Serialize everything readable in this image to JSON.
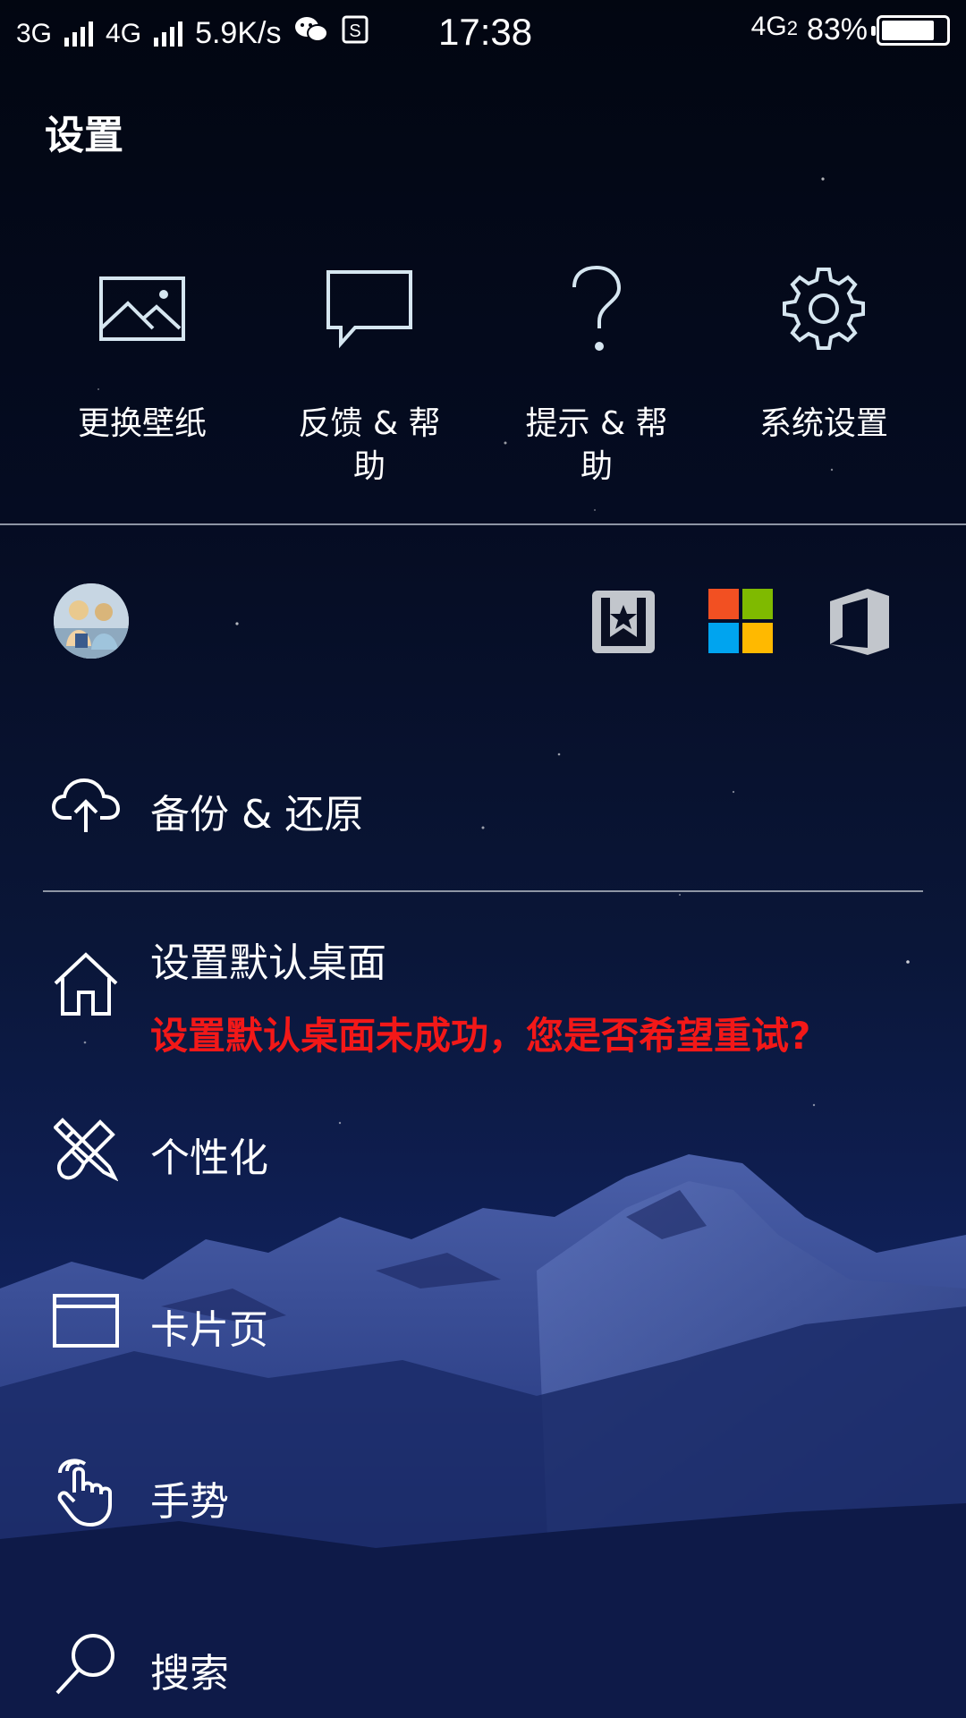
{
  "status_bar": {
    "net1": "3G",
    "net2": "4G",
    "speed": "5.9K/s",
    "time": "17:38",
    "net3": "4G",
    "net3_sub": "2",
    "battery": "83%",
    "battery_level": 0.83
  },
  "page": {
    "title": "设置"
  },
  "quick_actions": [
    {
      "label": "更换壁纸",
      "icon": "image-icon"
    },
    {
      "label": "反馈 & 帮助",
      "icon": "chat-bubble-icon"
    },
    {
      "label": "提示 & 帮助",
      "icon": "question-icon"
    },
    {
      "label": "系统设置",
      "icon": "gear-icon"
    }
  ],
  "account_apps": [
    {
      "icon": "bookmark-star-icon"
    },
    {
      "icon": "microsoft-logo-icon",
      "colors": [
        "#f25022",
        "#7fba00",
        "#00a4ef",
        "#ffb900"
      ]
    },
    {
      "icon": "office-logo-icon"
    }
  ],
  "menu": [
    {
      "label": "备份 & 还原",
      "icon": "cloud-upload-icon"
    },
    {
      "label": "设置默认桌面",
      "sub": "设置默认桌面未成功，您是否希望重试?",
      "icon": "home-icon"
    },
    {
      "label": "个性化",
      "icon": "brush-pencil-icon"
    },
    {
      "label": "卡片页",
      "icon": "card-icon"
    },
    {
      "label": "手势",
      "icon": "hand-gesture-icon"
    },
    {
      "label": "搜索",
      "icon": "search-icon"
    }
  ],
  "colors": {
    "error": "#f31818",
    "divider": "#8e95a4"
  }
}
